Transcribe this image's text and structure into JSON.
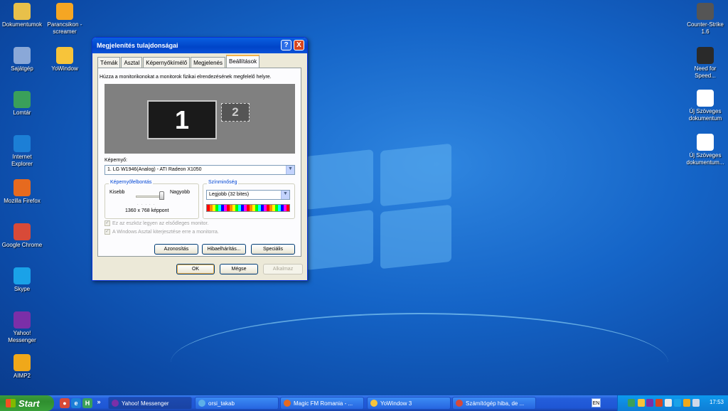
{
  "desktop": {
    "left_icons": [
      {
        "label": "Dokumentumok",
        "icon": "documents-folder-icon",
        "color": "#e8c04a"
      },
      {
        "label": "Parancsikon -\nscreamer",
        "icon": "screamer-icon",
        "color": "#f5a623"
      },
      {
        "label": "Sajátgép",
        "icon": "my-computer-icon",
        "color": "#8aa8d8"
      },
      {
        "label": "YoWindow",
        "icon": "yowindow-icon",
        "color": "#f7c43a"
      },
      {
        "label": "Lomtár",
        "icon": "recycle-bin-icon",
        "color": "#3aa05a"
      },
      {
        "label": "Internet\nExplorer",
        "icon": "internet-explorer-icon",
        "color": "#1c7fd6"
      },
      {
        "label": "Mozilla Firefox",
        "icon": "firefox-icon",
        "color": "#e66a1f"
      },
      {
        "label": "Google Chrome",
        "icon": "chrome-icon",
        "color": "#d84a38"
      },
      {
        "label": "Skype",
        "icon": "skype-icon",
        "color": "#1aa2e8"
      },
      {
        "label": "Yahoo!\nMessenger",
        "icon": "yahoo-messenger-icon",
        "color": "#7b2fa8"
      },
      {
        "label": "AIMP2",
        "icon": "aimp-icon",
        "color": "#f0a81a"
      }
    ],
    "right_icons": [
      {
        "label": "Counter-Strike\n1.6",
        "icon": "counter-strike-icon",
        "color": "#555555"
      },
      {
        "label": "Need for\nSpeed...",
        "icon": "need-for-speed-icon",
        "color": "#2a2a2a"
      },
      {
        "label": "Új Szöveges\ndokumentum",
        "icon": "text-document-icon",
        "color": "#ffffff"
      },
      {
        "label": "Új Szöveges\ndokumentum...",
        "icon": "text-document-icon",
        "color": "#ffffff"
      }
    ]
  },
  "dialog": {
    "title": "Megjelenítés tulajdonságai",
    "help_glyph": "?",
    "close_glyph": "X",
    "tabs": [
      "Témák",
      "Asztal",
      "Képernyőkímélő",
      "Megjelenés",
      "Beállítások"
    ],
    "instruction": "Húzza a monitorikonokat a monitorok fizikai elrendezésének megfelelő helyre.",
    "monitor1": "1",
    "monitor2": "2",
    "display_label": "Képernyő:",
    "display_value": "1. LG W1946(Analog) - ATI Radeon X1050",
    "resolution_group": "Képernyőfelbontás",
    "less": "Kisebb",
    "more": "Nagyobb",
    "resolution_value": "1360 x 768 képpont",
    "color_group": "Színminőség",
    "color_value": "Legjobb (32 bites)",
    "check1": "Ez az eszköz legyen az elsődleges monitor.",
    "check2": "A Windows Asztal kiterjesztése erre a monitorra.",
    "identify": "Azonosítás",
    "troubleshoot": "Hibaelhárítás...",
    "advanced": "Speciális",
    "ok": "OK",
    "cancel": "Mégse",
    "apply": "Alkalmaz",
    "dropdown_glyph": "▼"
  },
  "taskbar": {
    "start": "Start",
    "more_glyph": "»",
    "tasks": [
      {
        "label": "Yahoo! Messenger",
        "icon_color": "#7b2fa8",
        "active": true
      },
      {
        "label": "orsi_takab",
        "icon_color": "#5db0e8",
        "active": false
      },
      {
        "label": "Magic FM Romania - ...",
        "icon_color": "#e66a1f",
        "active": false
      },
      {
        "label": "YoWindow 3",
        "icon_color": "#f7c43a",
        "active": false
      },
      {
        "label": "Számítógép hiba, de ...",
        "icon_color": "#d84a38",
        "active": false
      }
    ],
    "lang": "EN",
    "clock": "17:53"
  }
}
